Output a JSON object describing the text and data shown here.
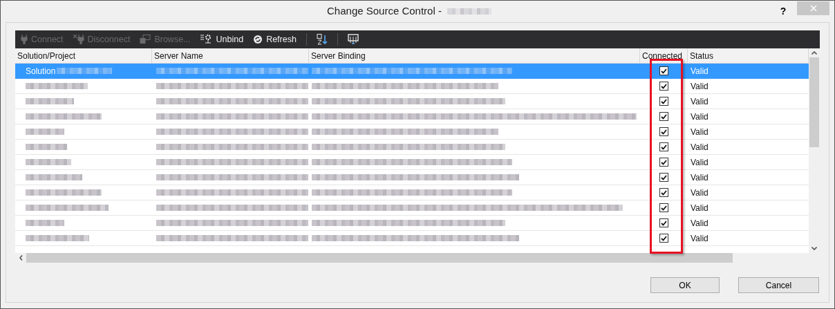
{
  "window": {
    "title": "Change Source Control -",
    "help": "?"
  },
  "toolbar": [
    {
      "kind": "plug",
      "label": "Connect",
      "disabled": true
    },
    {
      "kind": "unplug",
      "label": "Disconnect",
      "disabled": true
    },
    {
      "kind": "browse",
      "label": "Browse...",
      "disabled": true
    },
    {
      "kind": "unbind",
      "label": "Unbind",
      "disabled": false
    },
    {
      "kind": "refresh",
      "label": "Refresh",
      "disabled": false
    },
    {
      "kind": "sort",
      "disabled": false
    },
    {
      "kind": "display",
      "disabled": false
    }
  ],
  "table": {
    "columns": [
      "Solution/Project",
      "Server Name",
      "Server Binding",
      "Connected",
      "Status"
    ],
    "rows": [
      {
        "label": "Solution",
        "selected": true,
        "connected": true,
        "status": "Valid"
      },
      {
        "selected": false,
        "connected": true,
        "status": "Valid"
      },
      {
        "selected": false,
        "connected": true,
        "status": "Valid"
      },
      {
        "selected": false,
        "connected": true,
        "status": "Valid"
      },
      {
        "selected": false,
        "connected": true,
        "status": "Valid"
      },
      {
        "selected": false,
        "connected": true,
        "status": "Valid"
      },
      {
        "selected": false,
        "connected": true,
        "status": "Valid"
      },
      {
        "selected": false,
        "connected": true,
        "status": "Valid"
      },
      {
        "selected": false,
        "connected": true,
        "status": "Valid"
      },
      {
        "selected": false,
        "connected": true,
        "status": "Valid"
      },
      {
        "selected": false,
        "connected": true,
        "status": "Valid"
      },
      {
        "selected": false,
        "connected": true,
        "status": "Valid"
      }
    ]
  },
  "annotation": {
    "kind": "highlight-box",
    "color": "#e81123"
  },
  "buttons": [
    "OK",
    "Cancel"
  ]
}
